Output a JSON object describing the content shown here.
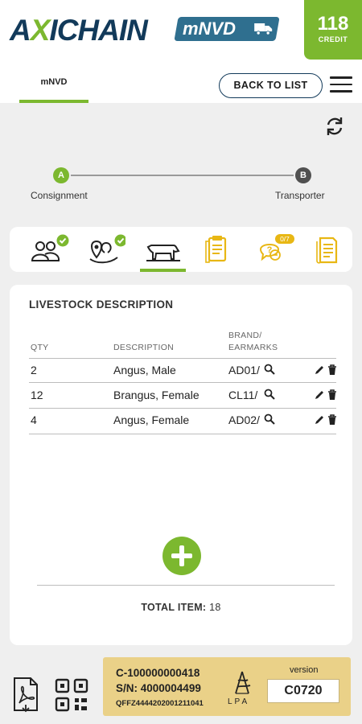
{
  "header": {
    "logo_main": "AXICHAIN",
    "logo_badge": "mNVD",
    "credit_count": "118",
    "credit_label": "CREDIT",
    "tab_label": "mNVD",
    "back_button": "BACK TO LIST"
  },
  "stepper": {
    "steps": [
      {
        "letter": "A",
        "label": "Consignment",
        "state": "active"
      },
      {
        "letter": "B",
        "label": "Transporter",
        "state": "pending"
      }
    ]
  },
  "section_icons": {
    "badge_count": "0/7",
    "items": [
      "people-check-icon",
      "location-check-icon",
      "cattle-icon",
      "clipboard-icon",
      "chat-question-icon",
      "document-icon"
    ]
  },
  "livestock": {
    "title": "LIVESTOCK DESCRIPTION",
    "columns": {
      "qty": "QTY",
      "description": "DESCRIPTION",
      "brand_line1": "BRAND/",
      "brand_line2": "EARMARKS"
    },
    "rows": [
      {
        "qty": "2",
        "description": "Angus, Male",
        "brand": "AD01/"
      },
      {
        "qty": "12",
        "description": "Brangus, Female",
        "brand": "CL11/"
      },
      {
        "qty": "4",
        "description": "Angus, Female",
        "brand": "AD02/"
      }
    ],
    "total_label": "TOTAL ITEM:",
    "total_value": "18"
  },
  "footer": {
    "consignment_id": "C-100000000418",
    "serial": "S/N: 4000004499",
    "code": "QFFZ4444202001211041",
    "lpa_label": "LPA",
    "version_label": "version",
    "version_value": "C0720"
  },
  "colors": {
    "brand_green": "#7cb82f",
    "brand_navy": "#123a5a",
    "footer_gold": "#ead188",
    "accent_yellow": "#e8b714"
  }
}
